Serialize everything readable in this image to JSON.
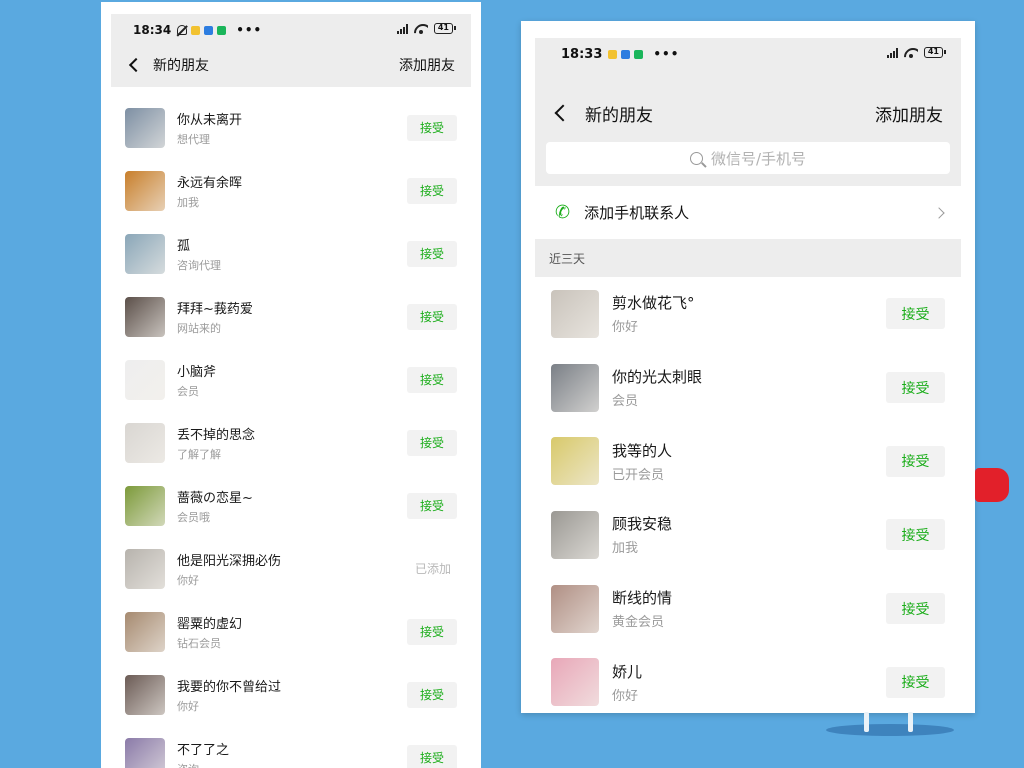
{
  "left_screen": {
    "status": {
      "time": "18:34",
      "battery": "41"
    },
    "nav": {
      "title": "新的朋友",
      "action": "添加朋友"
    },
    "requests": [
      {
        "name": "你从未离开",
        "message": "想代理",
        "status": "接受",
        "avatar_color": "#7d8fa3"
      },
      {
        "name": "永远有余晖",
        "message": "加我",
        "status": "接受",
        "avatar_color": "#c87f2c"
      },
      {
        "name": "孤",
        "message": "咨询代理",
        "status": "接受",
        "avatar_color": "#8aa6b8"
      },
      {
        "name": "拜拜~莪药爱",
        "message": "网站来的",
        "status": "接受",
        "avatar_color": "#5b4f49"
      },
      {
        "name": "小脑斧",
        "message": "会员",
        "status": "接受",
        "avatar_color": "#eeeeee"
      },
      {
        "name": "丢不掉的思念",
        "message": "了解了解",
        "status": "接受",
        "avatar_color": "#d9d6d2"
      },
      {
        "name": "蔷薇の恋星~",
        "message": "会员哦",
        "status": "接受",
        "avatar_color": "#7c9a3a"
      },
      {
        "name": "他是阳光深拥必伤",
        "message": "你好",
        "status": "已添加",
        "avatar_color": "#b7b3ad"
      },
      {
        "name": "罂粟的虚幻",
        "message": "钻石会员",
        "status": "接受",
        "avatar_color": "#a68a70"
      },
      {
        "name": "我要的你不曾给过",
        "message": "你好",
        "status": "接受",
        "avatar_color": "#6b5b55"
      },
      {
        "name": "不了了之",
        "message": "咨询",
        "status": "接受",
        "avatar_color": "#8a7aa8"
      }
    ]
  },
  "right_screen": {
    "status": {
      "time": "18:33",
      "battery": "41"
    },
    "nav": {
      "title": "新的朋友",
      "action": "添加朋友"
    },
    "search": {
      "placeholder": "微信号/手机号"
    },
    "add_contacts": {
      "label": "添加手机联系人"
    },
    "section_label": "近三天",
    "requests": [
      {
        "name": "剪水做花飞°",
        "message": "你好",
        "status": "接受",
        "avatar_color": "#c9c3bb"
      },
      {
        "name": "你的光太刺眼",
        "message": "会员",
        "status": "接受",
        "avatar_color": "#7a7f86"
      },
      {
        "name": "我等的人",
        "message": "已开会员",
        "status": "接受",
        "avatar_color": "#d8c96a"
      },
      {
        "name": "顾我安稳",
        "message": "加我",
        "status": "接受",
        "avatar_color": "#9a9893"
      },
      {
        "name": "断线的情",
        "message": "黄金会员",
        "status": "接受",
        "avatar_color": "#b08f84"
      },
      {
        "name": "娇儿",
        "message": "你好",
        "status": "接受",
        "avatar_color": "#e8a7b8"
      }
    ]
  }
}
